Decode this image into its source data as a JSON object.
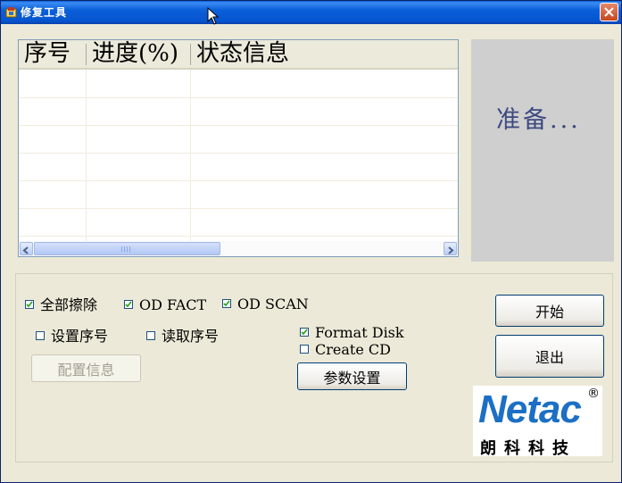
{
  "window": {
    "title": "修复工具",
    "app_icon": "app-icon",
    "close_icon": "close-icon"
  },
  "listview": {
    "columns": [
      "序号",
      "进度(%)",
      "状态信息"
    ],
    "rows": []
  },
  "status": {
    "text": "准备..."
  },
  "options": {
    "full_erase": {
      "label": "全部擦除",
      "checked": true
    },
    "od_fact": {
      "label": "OD FACT",
      "checked": true
    },
    "od_scan": {
      "label": "OD SCAN",
      "checked": true
    },
    "set_serial": {
      "label": "设置序号",
      "checked": false
    },
    "read_serial": {
      "label": "读取序号",
      "checked": false
    },
    "format_disk": {
      "label": "Format Disk",
      "checked": true
    },
    "create_cd": {
      "label": "Create CD",
      "checked": false
    }
  },
  "buttons": {
    "config_info": "配置信息",
    "param_settings": "参数设置",
    "start": "开始",
    "exit": "退出"
  },
  "logo": {
    "brand": "Netac",
    "reg": "®",
    "cn": "朗科科技",
    "color": "#1c6fc4"
  },
  "colors": {
    "titlebar": "#0a5fd8",
    "status_text": "#3d4a80",
    "status_bg": "#cfcfcf",
    "dialog_bg": "#ece9d8"
  }
}
